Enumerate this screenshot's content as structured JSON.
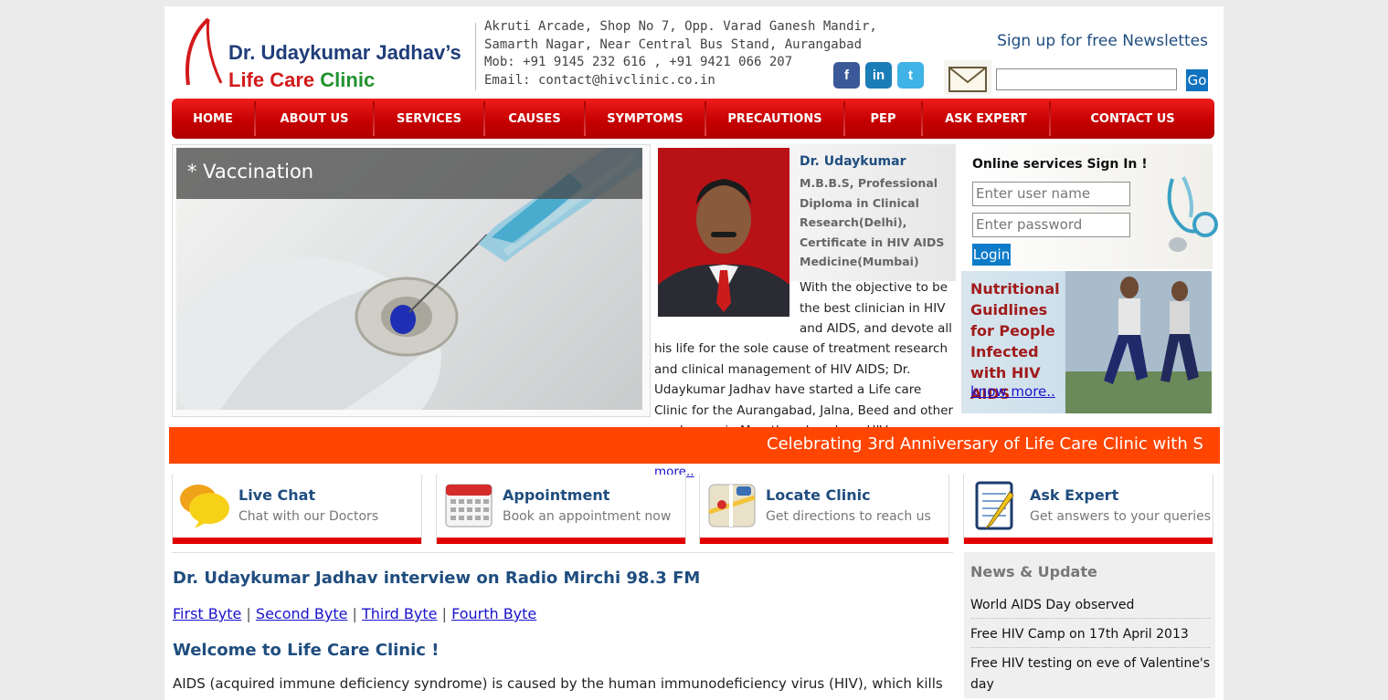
{
  "header": {
    "logo_name": "Dr. Udaykumar Jadhav’s",
    "logo_clinic_part1": "Life Care",
    "logo_clinic_part2": "Clinic",
    "address_lines": [
      "Akruti Arcade, Shop No 7, Opp. Varad Ganesh Mandir,",
      "Samarth Nagar, Near Central Bus Stand, Aurangabad",
      "Mob: +91 9145 232 616 , +91 9421 066 207",
      "Email: contact@hivclinic.co.in"
    ],
    "newsletter_title": "Sign up for free Newslettes",
    "newsletter_go": "Go",
    "social": {
      "facebook": "f",
      "linkedin": "in",
      "twitter": "t"
    }
  },
  "nav": {
    "items": [
      "HOME",
      "ABOUT US",
      "SERVICES",
      "CAUSES",
      "SYMPTOMS",
      "PRECAUTIONS",
      "PEP",
      "ASK EXPERT",
      "CONTACT US"
    ]
  },
  "slider": {
    "caption": "* Vaccination"
  },
  "doctor": {
    "name": "Dr. Udaykumar",
    "qualifications": "M.B.B.S, Professional Diploma in Clinical Research(Delhi), Certificate in HIV AIDS Medicine(Mumbai)",
    "desc_top": "With the objective to be the best clinician in HIV and AIDS, and devote all",
    "desc_bottom": "his life for the sole cause of treatment research and clinical management of HIV AIDS; Dr. Udaykumar Jadhav have started a Life care Clinic for the Aurangabad, Jalna, Beed and other rural areas in Marathwada; where HIV awareness amongst people is very less.",
    "read_more": "read more.."
  },
  "signin": {
    "title": "Online services Sign In !",
    "username_placeholder": "Enter user name",
    "password_placeholder": "Enter password",
    "login": "Login"
  },
  "promo": {
    "title": "Nutritional Guidlines for People Infected with HIV AIDS",
    "link": "know more.."
  },
  "ticker": {
    "text": "Celebrating 3rd Anniversary of Life Care Clinic with S"
  },
  "services": [
    {
      "title": "Live Chat",
      "sub": "Chat with our Doctors",
      "icon": "chat-bubbles-icon"
    },
    {
      "title": "Appointment",
      "sub": "Book an appointment now",
      "icon": "calendar-icon"
    },
    {
      "title": "Locate Clinic",
      "sub": "Get directions to reach us",
      "icon": "map-icon"
    },
    {
      "title": "Ask Expert",
      "sub": "Get answers to your queries",
      "icon": "notepad-icon"
    }
  ],
  "content": {
    "interview_title": "Dr. Udaykumar Jadhav interview on Radio Mirchi 98.3 FM",
    "bytes": [
      "First Byte",
      "Second Byte",
      "Third Byte",
      "Fourth Byte"
    ],
    "byte_separator": "|",
    "welcome": "Welcome to Life Care Clinic !",
    "intro": "AIDS (acquired immune deficiency syndrome) is caused by the human immunodeficiency virus (HIV), which kills"
  },
  "news": {
    "title": "News & Update",
    "items": [
      "World AIDS Day observed",
      "Free HIV Camp on 17th April 2013",
      "Free HIV testing on eve of Valentine's day"
    ]
  },
  "colors": {
    "nav_red": "#d40000",
    "ticker_orange": "#ff4500",
    "heading_blue": "#1f4d7f",
    "service_bar": "#e10000"
  }
}
